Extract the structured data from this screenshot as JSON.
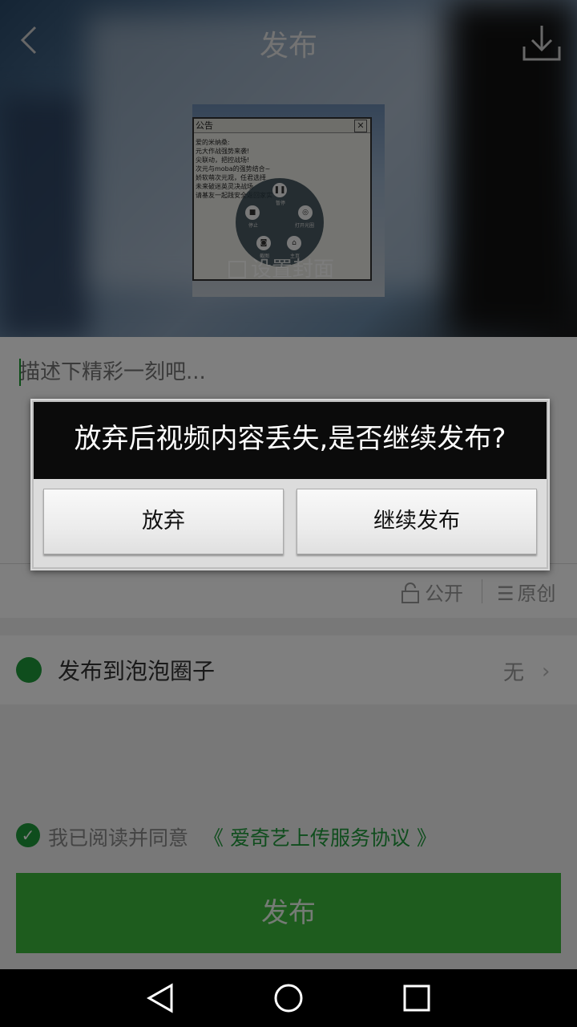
{
  "header": {
    "title": "发布"
  },
  "cover": {
    "label": "设置封面",
    "thumb_dialog_title": "公告",
    "thumb_lines": [
      "爱的米纳桑:",
      "元大作战强势来袭!",
      "尖联动，把控战场!",
      "次元与moba的强势结合~",
      "娇软萌次元观，任君选择",
      "未来破迷英灵决战场",
      "请基友一起践安全返回家实"
    ],
    "thumb_controls": [
      "暂停",
      "停止",
      "打开光圈",
      "截图",
      "主页"
    ]
  },
  "description": {
    "placeholder": "描述下精彩一刻吧..."
  },
  "options": {
    "privacy": "公开",
    "origin": "原创"
  },
  "circle": {
    "label": "发布到泡泡圈子",
    "value": "无"
  },
  "agreement": {
    "prefix": "我已阅读并同意",
    "link": "《 爱奇艺上传服务协议 》"
  },
  "publish_button": "发布",
  "dialog": {
    "message": "放弃后视频内容丢失,是否继续发布?",
    "discard": "放弃",
    "continue": "继续发布"
  },
  "colors": {
    "accent": "#1f9a3a",
    "publish": "#3cb83c"
  }
}
